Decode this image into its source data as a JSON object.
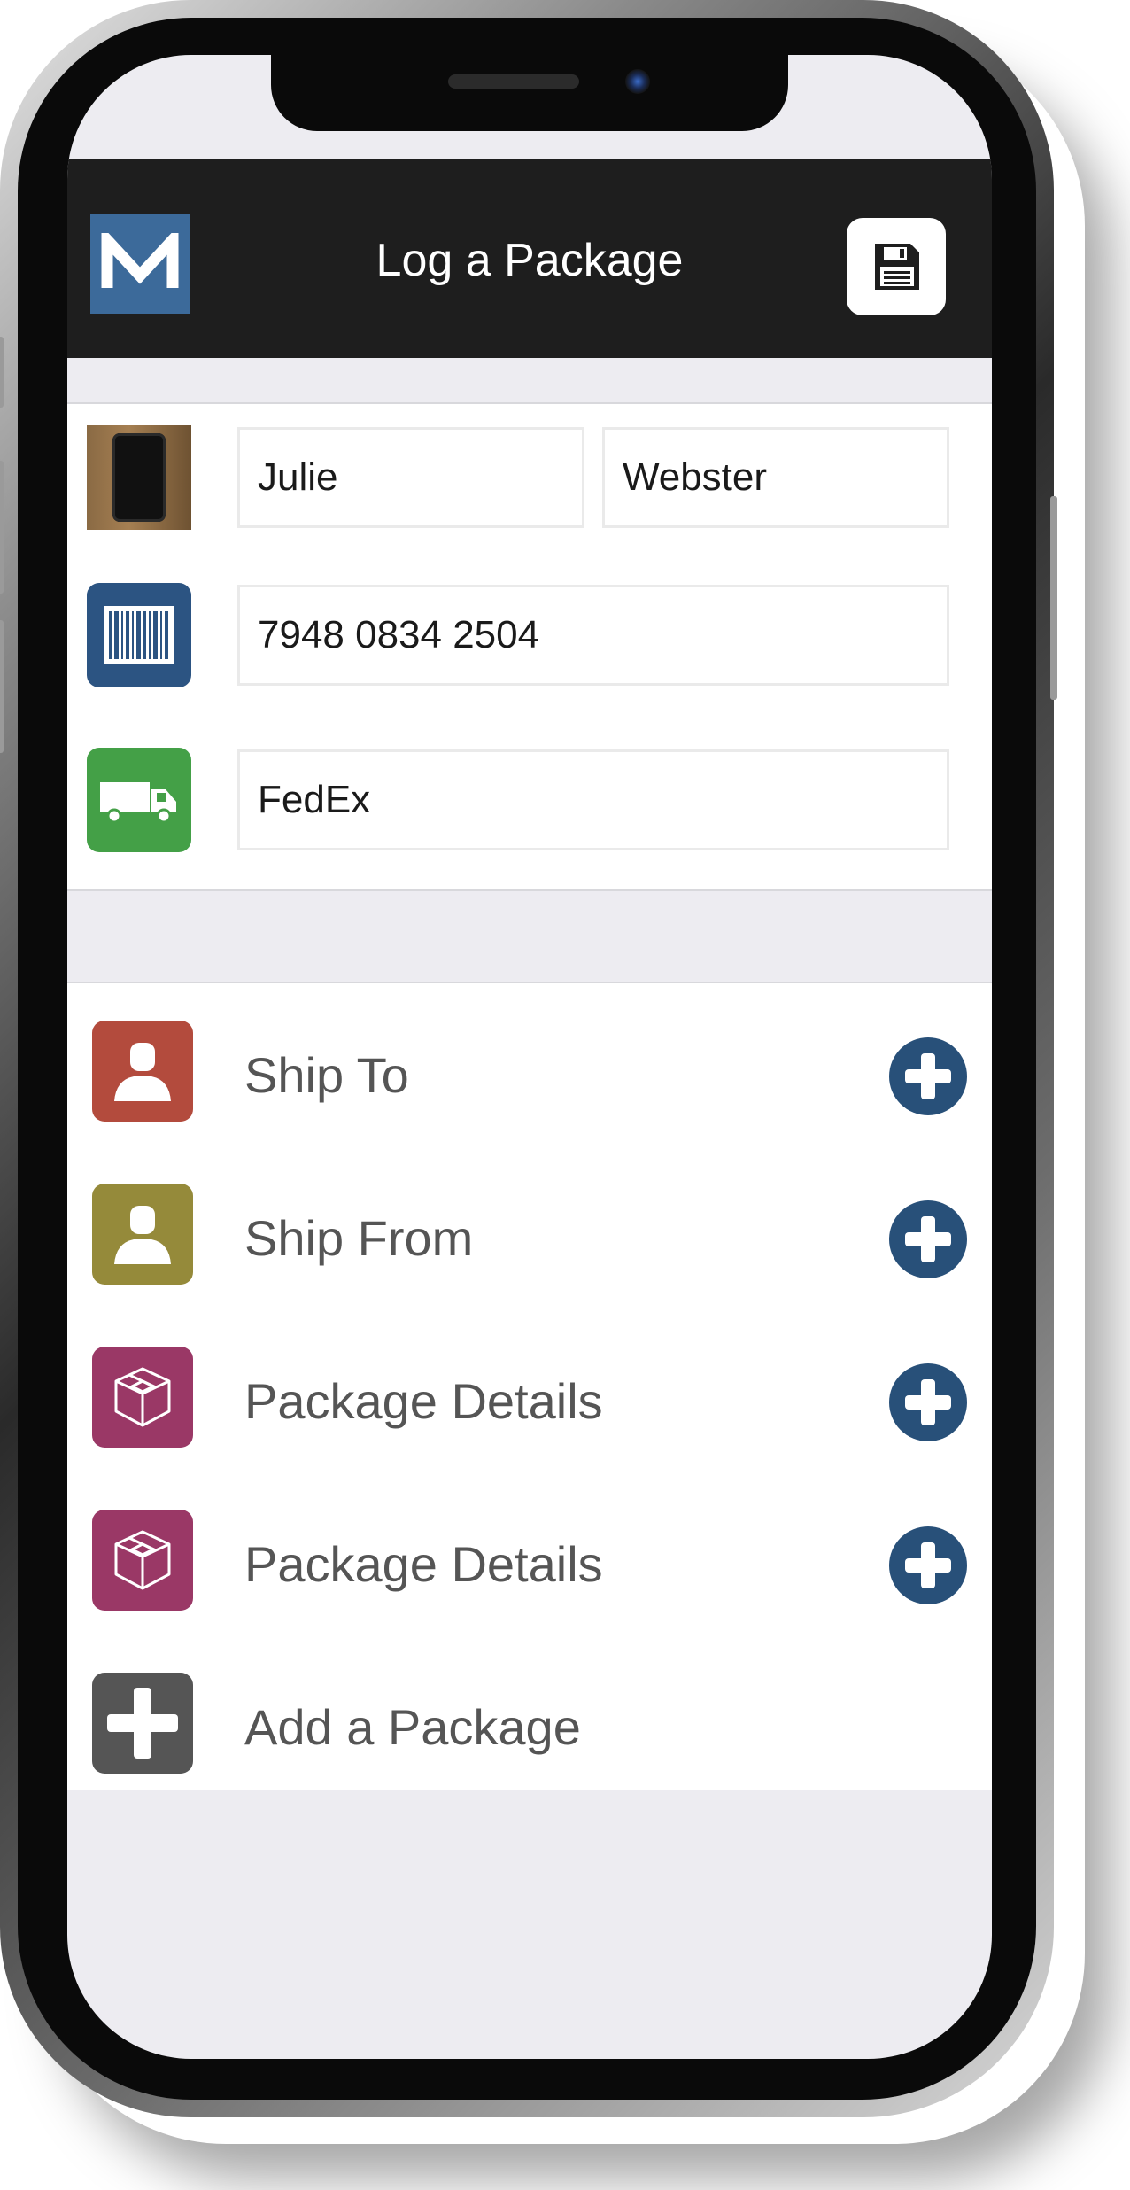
{
  "header": {
    "logo_letter": "M",
    "title": "Log a Package",
    "save_icon": "floppy-disk-icon"
  },
  "form": {
    "first_name": "Julie",
    "last_name": "Webster",
    "tracking_number": "7948 0834 2504",
    "carrier": "FedEx",
    "icons": [
      "package-photo",
      "barcode-icon",
      "truck-icon"
    ]
  },
  "list": {
    "items": [
      {
        "label": "Ship To",
        "icon": "person-icon",
        "color": "#b34b3d"
      },
      {
        "label": "Ship From",
        "icon": "person-icon",
        "color": "#958a3a"
      },
      {
        "label": "Package Details",
        "icon": "box-icon",
        "color": "#9a3866"
      },
      {
        "label": "Package Details",
        "icon": "box-icon",
        "color": "#9a3866"
      }
    ],
    "add_label": "Add a Package"
  },
  "colors": {
    "header_bg": "#1e1e1e",
    "logo_bg": "#3c6a9a",
    "barcode_bg": "#2c5482",
    "truck_bg": "#44a047",
    "plus_button": "#285079",
    "add_bg": "#555555",
    "screen_bg": "#edecf1"
  }
}
